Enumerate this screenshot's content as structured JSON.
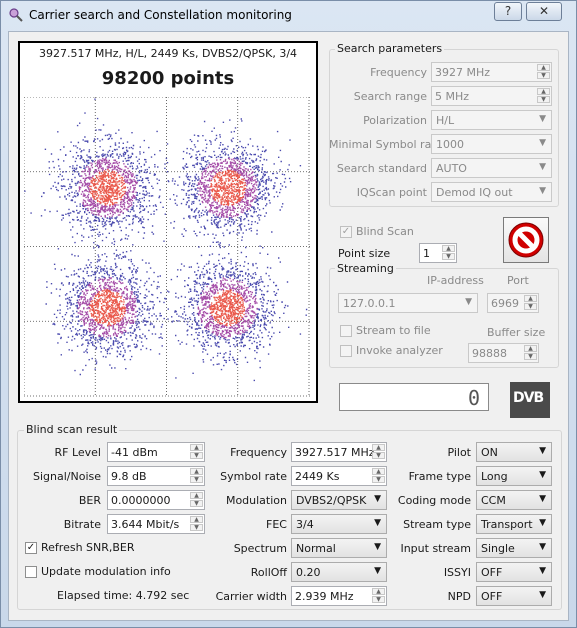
{
  "window": {
    "title": "Carrier search and Constellation monitoring",
    "help_glyph": "?",
    "close_glyph": "✕"
  },
  "plot": {
    "info": "3927.517 MHz, H/L, 2449 Ks, DVBS2/QPSK, 3/4",
    "points": "98200 points"
  },
  "search": {
    "title": "Search parameters",
    "frequency_label": "Frequency",
    "frequency": "3927 MHz",
    "range_label": "Search range",
    "range": "5 MHz",
    "polarization_label": "Polarization",
    "polarization": "H/L",
    "minsr_label": "Minimal Symbol rate",
    "minsr": "1000",
    "standard_label": "Search standard",
    "standard": "AUTO",
    "iqscan_label": "IQScan point",
    "iqscan": "Demod IQ out"
  },
  "controls": {
    "blind_scan": "Blind Scan",
    "point_size_label": "Point size",
    "point_size": "1"
  },
  "streaming": {
    "title": "Streaming",
    "ip_label": "IP-address",
    "port_label": "Port",
    "ip": "127.0.0.1",
    "port": "6969",
    "to_file": "Stream to file",
    "buffer_label": "Buffer size",
    "invoke": "Invoke analyzer",
    "buffer": "98888"
  },
  "counter": "0",
  "logo_text": "DVB",
  "result": {
    "title": "Blind scan result",
    "rf_label": "RF Level",
    "rf": "-41 dBm",
    "snr_label": "Signal/Noise",
    "snr": "9.8 dB",
    "ber_label": "BER",
    "ber": "0.0000000",
    "bitrate_label": "Bitrate",
    "bitrate": "3.644 Mbit/s",
    "refresh": "Refresh SNR,BER",
    "update": "Update modulation info",
    "elapsed": "Elapsed time: 4.792 sec",
    "freq_label": "Frequency",
    "freq": "3927.517 MHz",
    "sr_label": "Symbol rate",
    "sr": "2449 Ks",
    "mod_label": "Modulation",
    "mod": "DVBS2/QPSK",
    "fec_label": "FEC",
    "fec": "3/4",
    "spectrum_label": "Spectrum",
    "spectrum": "Normal",
    "rolloff_label": "RollOff",
    "rolloff": "0.20",
    "cw_label": "Carrier width",
    "cw": "2.939 MHz",
    "pilot_label": "Pilot",
    "pilot": "ON",
    "frame_label": "Frame type",
    "frame": "Long",
    "coding_label": "Coding mode",
    "coding": "CCM",
    "stream_label": "Stream type",
    "stream": "Transport",
    "input_label": "Input stream",
    "input": "Single",
    "issyi_label": "ISSYI",
    "issyi": "OFF",
    "npd_label": "NPD",
    "npd": "OFF"
  },
  "colors": {
    "accent": "#d00000",
    "cloud_core": "#e8483a",
    "cloud_edge": "#2a2aa0"
  }
}
